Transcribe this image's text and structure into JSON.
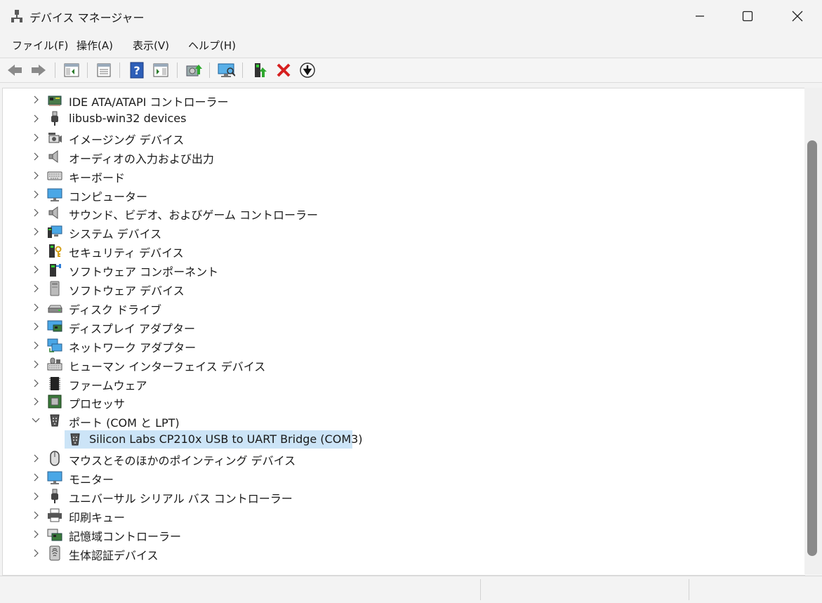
{
  "window": {
    "title": "デバイス マネージャー",
    "controls": [
      "minimize",
      "maximize",
      "close"
    ]
  },
  "menu": [
    {
      "label": "ファイル(F)"
    },
    {
      "label": "操作(A)"
    },
    {
      "label": "表示(V)"
    },
    {
      "label": "ヘルプ(H)"
    }
  ],
  "toolbar": {
    "icons": [
      "back-icon",
      "forward-icon",
      "show-hide-console-tree-icon",
      "properties-icon",
      "help-icon",
      "action-pane-icon",
      "update-driver-icon",
      "scan-hardware-icon",
      "enable-device-icon",
      "uninstall-device-icon",
      "disable-device-icon"
    ]
  },
  "tree": {
    "categories": [
      {
        "label": "IDE ATA/ATAPI コントローラー",
        "icon": "ide-controller-icon"
      },
      {
        "label": "libusb-win32 devices",
        "icon": "usb-plug-icon"
      },
      {
        "label": "イメージング デバイス",
        "icon": "camera-icon"
      },
      {
        "label": "オーディオの入力および出力",
        "icon": "speaker-icon"
      },
      {
        "label": "キーボード",
        "icon": "keyboard-icon"
      },
      {
        "label": "コンピューター",
        "icon": "monitor-icon"
      },
      {
        "label": "サウンド、ビデオ、およびゲーム コントローラー",
        "icon": "speaker-icon"
      },
      {
        "label": "システム デバイス",
        "icon": "system-devices-icon"
      },
      {
        "label": "セキュリティ デバイス",
        "icon": "security-key-icon"
      },
      {
        "label": "ソフトウェア コンポーネント",
        "icon": "software-component-icon"
      },
      {
        "label": "ソフトウェア デバイス",
        "icon": "software-device-icon"
      },
      {
        "label": "ディスク ドライブ",
        "icon": "disk-drive-icon"
      },
      {
        "label": "ディスプレイ アダプター",
        "icon": "display-adapter-icon"
      },
      {
        "label": "ネットワーク アダプター",
        "icon": "network-adapter-icon"
      },
      {
        "label": "ヒューマン インターフェイス デバイス",
        "icon": "hid-icon"
      },
      {
        "label": "ファームウェア",
        "icon": "firmware-chip-icon"
      },
      {
        "label": "プロセッサ",
        "icon": "processor-icon"
      },
      {
        "label": "ポート (COM と LPT)",
        "icon": "port-icon",
        "expanded": true,
        "children": [
          {
            "label": "Silicon Labs CP210x USB to UART Bridge (COM3)",
            "icon": "port-icon",
            "selected": true
          }
        ]
      },
      {
        "label": "マウスとそのほかのポインティング デバイス",
        "icon": "mouse-icon"
      },
      {
        "label": "モニター",
        "icon": "monitor-icon"
      },
      {
        "label": "ユニバーサル シリアル バス コントローラー",
        "icon": "usb-plug-icon"
      },
      {
        "label": "印刷キュー",
        "icon": "printer-icon"
      },
      {
        "label": "記憶域コントローラー",
        "icon": "storage-controller-icon"
      },
      {
        "label": "生体認証デバイス",
        "icon": "biometric-icon"
      }
    ]
  }
}
